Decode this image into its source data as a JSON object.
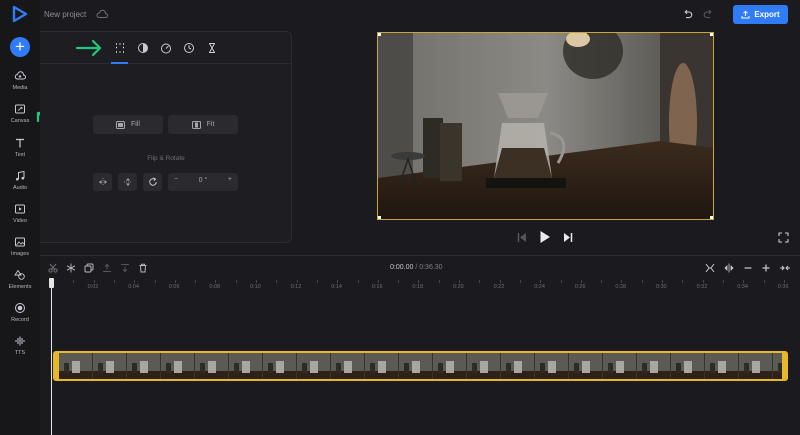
{
  "header": {
    "project_title": "New project",
    "export_label": "Export"
  },
  "sidebar": {
    "items": [
      {
        "label": "Media",
        "icon": "cloud-upload-icon"
      },
      {
        "label": "Canvas",
        "icon": "canvas-icon"
      },
      {
        "label": "Text",
        "icon": "text-icon"
      },
      {
        "label": "Audio",
        "icon": "music-icon"
      },
      {
        "label": "Video",
        "icon": "video-icon"
      },
      {
        "label": "Images",
        "icon": "image-icon"
      },
      {
        "label": "Elements",
        "icon": "shapes-icon"
      },
      {
        "label": "Record",
        "icon": "record-icon"
      },
      {
        "label": "TTS",
        "icon": "waveform-icon"
      }
    ]
  },
  "panel": {
    "tabs": [
      "canvas-size-icon",
      "filters-icon",
      "speed-icon",
      "duration-icon",
      "hourglass-icon"
    ],
    "fill_label": "Fill",
    "fit_label": "Fit",
    "flip_rotate_label": "Flip & Rotate",
    "rotation_value": "0 °",
    "minus": "−",
    "plus": "+"
  },
  "timeline": {
    "current_time": "0:00.00",
    "separator": "/",
    "total_time": "0:36.30",
    "ruler_ticks": [
      "0:02",
      "0:04",
      "0:06",
      "0:08",
      "0:10",
      "0:12",
      "0:14",
      "0:16",
      "0:18",
      "0:20",
      "0:22",
      "0:24",
      "0:26",
      "0:28",
      "0:30",
      "0:32",
      "0:34",
      "0:36"
    ]
  },
  "colors": {
    "accent": "#2f7cf6",
    "clip_border": "#e8b82a",
    "annotation_arrow": "#1ec87a"
  }
}
